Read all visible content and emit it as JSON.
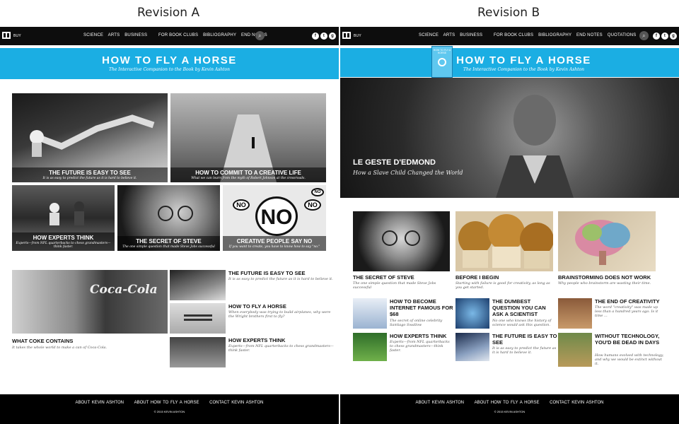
{
  "captions": {
    "a": "Revision A",
    "b": "Revision B"
  },
  "nav": {
    "buy": "BUY",
    "items_a": [
      "SCIENCE",
      "ARTS",
      "BUSINESS",
      "FOR BOOK CLUBS",
      "BIBLIOGRAPHY",
      "END NOTES"
    ],
    "items_b": [
      "SCIENCE",
      "ARTS",
      "BUSINESS",
      "FOR BOOK CLUBS",
      "BIBLIOGRAPHY",
      "END NOTES",
      "QUOTATIONS"
    ],
    "social": [
      "f",
      "t",
      "g"
    ]
  },
  "banner": {
    "title": "HOW TO FLY A HORSE",
    "subtitle": "The Interactive Companion to the Book by Kevin Ashton"
  },
  "a": {
    "tiles": [
      {
        "title": "THE FUTURE IS EASY TO SEE",
        "desc": "It is as easy to predict the future as it is hard to believe it."
      },
      {
        "title": "HOW TO COMMIT TO A CREATIVE LIFE",
        "desc": "What we can learn from the myth of Robert Johnson at the crossroads."
      },
      {
        "title": "HOW EXPERTS THINK",
        "desc": "Experts—from NFL quarterbacks to chess grandmasters—think faster."
      },
      {
        "title": "THE SECRET OF STEVE",
        "desc": "The one simple question that made Steve Jobs successful"
      },
      {
        "title": "CREATIVE PEOPLE SAY NO",
        "desc": "If you want to create, you have to know how to say \"no.\""
      }
    ],
    "no_sign": [
      "NO",
      "NO",
      "NO",
      "NO"
    ],
    "coke": {
      "title": "WHAT COKE CONTAINS",
      "desc": "It takes the whole world to make a can of Coca-Cola.",
      "sign": "Coca-Cola"
    },
    "list": [
      {
        "title": "THE FUTURE IS EASY TO SEE",
        "desc": "It is as easy to predict the future as it is hard to believe it."
      },
      {
        "title": "HOW TO FLY A HORSE",
        "desc": "When everybody was trying to build airplanes, why were the Wright brothers first to fly?"
      },
      {
        "title": "HOW EXPERTS THINK",
        "desc": "Experts—from NFL quarterbacks to chess grandmasters—think faster."
      }
    ]
  },
  "b": {
    "book_cover": "HOW TO FLY A HORSE",
    "hero": {
      "title": "LE GESTE D'EDMOND",
      "desc": "How a Slave Child Changed the World"
    },
    "cards": [
      {
        "title": "THE SECRET OF STEVE",
        "desc": "The one simple question that made Steve Jobs successful"
      },
      {
        "title": "BEFORE I BEGIN",
        "desc": "Starting with failure is good for creativity, as long as you get started."
      },
      {
        "title": "BRAINSTORMING DOES NOT WORK",
        "desc": "Why people who brainstorm are wasting their time."
      }
    ],
    "items": [
      {
        "title": "HOW TO BECOME INTERNET FAMOUS FOR $68",
        "desc": "The secret of online celebrity Santiago Swallow"
      },
      {
        "title": "THE DUMBEST QUESTION YOU CAN ASK A SCIENTIST",
        "desc": "No one who knows the history of science would ask this question."
      },
      {
        "title": "THE END OF CREATIVITY",
        "desc": "The word \"creativity\" was made up less than a hundred years ago. Is it time ..."
      },
      {
        "title": "HOW EXPERTS THINK",
        "desc": "Experts—from NFL quarterbacks to chess grandmasters—think faster."
      },
      {
        "title": "THE FUTURE IS EASY TO SEE",
        "desc": "It is as easy to predict the future as it is hard to believe it."
      },
      {
        "title": "WITHOUT TECHNOLOGY, YOU'D BE DEAD IN DAYS",
        "desc": "How humans evolved with technology, and why we would be extinct without it."
      }
    ]
  },
  "footer": {
    "links": [
      "ABOUT KEVIN ASHTON",
      "ABOUT HOW TO FLY A HORSE",
      "CONTACT KEVIN ASHTON"
    ],
    "copy": "© 2015 KEVIN ASHTON"
  },
  "colors": {
    "accent": "#1baee3",
    "bar": "#0d0d0d"
  }
}
